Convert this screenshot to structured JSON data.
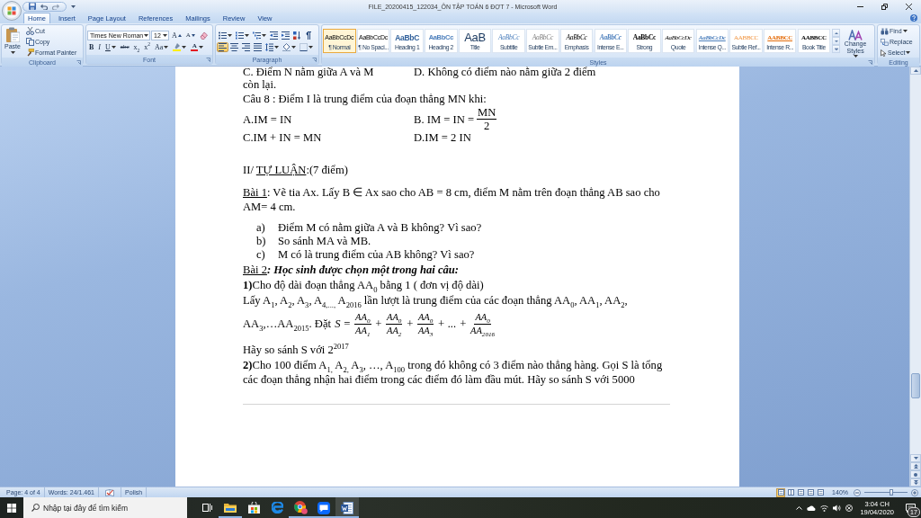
{
  "window": {
    "title": "FILE_20200415_122034_ÔN TẬP TOÁN 6 ĐỢT 7 - Microsoft Word"
  },
  "tabs": [
    {
      "label": "Home",
      "selected": true
    },
    {
      "label": "Insert",
      "selected": false
    },
    {
      "label": "Page Layout",
      "selected": false
    },
    {
      "label": "References",
      "selected": false
    },
    {
      "label": "Mailings",
      "selected": false
    },
    {
      "label": "Review",
      "selected": false
    },
    {
      "label": "View",
      "selected": false
    }
  ],
  "ribbon": {
    "clipboard": {
      "label": "Clipboard",
      "paste": "Paste",
      "commands": [
        {
          "kind": "cut",
          "label": "Cut"
        },
        {
          "kind": "copy",
          "label": "Copy"
        },
        {
          "kind": "painter",
          "label": "Format Painter"
        }
      ]
    },
    "font": {
      "label": "Font",
      "family": "Times New Roman",
      "size": "12",
      "row_1": [
        {
          "kind": "grow",
          "text": "A"
        },
        {
          "kind": "shrink",
          "text": "A"
        },
        {
          "kind": "clear"
        }
      ],
      "row_2": [
        {
          "kind": "bold",
          "text": "B"
        },
        {
          "kind": "italic",
          "text": "I"
        },
        {
          "kind": "underline",
          "text": "U"
        },
        {
          "kind": "strike",
          "text": "abc"
        },
        {
          "kind": "subscript",
          "text": "x$_{2}$"
        },
        {
          "kind": "superscript",
          "text": "x$^{2}$"
        },
        {
          "kind": "case",
          "text": "Aa"
        },
        {
          "kind": "highlight"
        },
        {
          "kind": "color",
          "text": "A"
        }
      ]
    },
    "paragraph": {
      "label": "Paragraph",
      "row_1": [
        {
          "kind": "bullets"
        },
        {
          "kind": "numbering"
        },
        {
          "kind": "multilevel"
        },
        {
          "kind": "outdent"
        },
        {
          "kind": "indent"
        },
        {
          "kind": "sort"
        },
        {
          "kind": "marks"
        }
      ],
      "row_2": [
        {
          "kind": "left",
          "selected": true
        },
        {
          "kind": "center",
          "selected": false
        },
        {
          "kind": "right",
          "selected": false
        },
        {
          "kind": "justify",
          "selected": false
        },
        {
          "kind": "spacing"
        },
        {
          "kind": "shading"
        },
        {
          "kind": "borders"
        }
      ]
    },
    "styles": {
      "label": "Styles",
      "items": [
        {
          "kind": "normal",
          "sample": "AaBbCcDc",
          "label": "¶ Normal",
          "selected": true
        },
        {
          "kind": "nospacing",
          "sample": "AaBbCcDc",
          "label": "¶ No Spaci...",
          "selected": false
        },
        {
          "kind": "heading1",
          "sample": "AaBbC",
          "label": "Heading 1",
          "selected": false
        },
        {
          "kind": "heading2",
          "sample": "AaBbCc",
          "label": "Heading 2",
          "selected": false
        },
        {
          "kind": "title",
          "sample": "AaB",
          "label": "Title",
          "selected": false
        },
        {
          "kind": "subtitle",
          "sample": "AaBbCc",
          "label": "Subtitle",
          "selected": false
        },
        {
          "kind": "subtleemphasis",
          "sample": "AaBbCc",
          "label": "Subtle Em...",
          "selected": false
        },
        {
          "kind": "emphasis",
          "sample": "AaBbCc",
          "label": "Emphasis",
          "selected": false
        },
        {
          "kind": "intenseemphasis",
          "sample": "AaBbCc",
          "label": "Intense E...",
          "selected": false
        },
        {
          "kind": "strong",
          "sample": "AaBbCc",
          "label": "Strong",
          "selected": false
        },
        {
          "kind": "quote",
          "sample": "AaBbCcDc",
          "label": "Quote",
          "selected": false
        },
        {
          "kind": "intensequote",
          "sample": "AaBbCcDc",
          "label": "Intense Q...",
          "selected": false
        },
        {
          "kind": "subtlereference",
          "sample": "AABBCC",
          "label": "Subtle Ref...",
          "selected": false
        },
        {
          "kind": "intensereference",
          "sample": "AABBCC",
          "label": "Intense R...",
          "selected": false
        },
        {
          "kind": "booktitle",
          "sample": "AABBCC",
          "label": "Book Title",
          "selected": false
        }
      ],
      "change_styles": "Change Styles"
    },
    "editing": {
      "label": "Editing",
      "commands": [
        {
          "kind": "find",
          "label": "Find"
        },
        {
          "kind": "replace",
          "label": "Replace"
        },
        {
          "kind": "select",
          "label": "Select"
        }
      ]
    }
  },
  "document": {
    "blocks": [
      {
        "kind": "options",
        "items": [
          {
            "text": "C. Điểm N nằm giữa A và M"
          },
          {
            "text": "D. Không có điểm nào nằm giữa 2 điểm"
          }
        ]
      },
      {
        "kind": "paragraph",
        "text": "còn lại."
      },
      {
        "kind": "paragraph",
        "text": "Câu 8 : Điểm I là trung điểm của đoạn thẳng MN khi:"
      },
      {
        "kind": "options",
        "items": [
          {
            "text": "A.IM = IN"
          },
          {
            "text": "B. IM = IN =",
            "fraction": {
              "numerator": "MN",
              "denominator": "2"
            }
          }
        ]
      },
      {
        "kind": "options",
        "items": [
          {
            "text": "C.IM + IN = MN"
          },
          {
            "text": "D.IM = 2 IN"
          }
        ]
      },
      {
        "kind": "section",
        "prefix": "II/ ",
        "underlined": "TỰ LUẬN",
        "suffix": ":(7 điểm)"
      },
      {
        "kind": "exercise",
        "label": "Bài 1",
        "text": ": Vẽ tia Ax. Lấy B ∈ Ax sao cho AB = 8 cm, điểm M nằm trên đoạn thẳng AB sao cho AM= 4 cm.",
        "emphasis": false
      },
      {
        "kind": "list",
        "items": [
          {
            "marker": "a)",
            "text": "Điểm M có nằm giữa A và B không? Vì sao?"
          },
          {
            "marker": "b)",
            "text": "So sánh MA và MB."
          },
          {
            "marker": "c)",
            "text": "M có là trung điểm của AB không? Vì sao?"
          }
        ]
      },
      {
        "kind": "exercise",
        "label": "Bài 2",
        "text": ": Học sinh được chọn một trong hai câu:",
        "emphasis": true
      },
      {
        "kind": "paragraph",
        "text": "**1)**Cho độ dài đoạn thẳng AA$_{0}$ bằng 1 ( đơn vị độ dài)"
      },
      {
        "kind": "paragraph",
        "text": "Lấy A$_{1}$, A$_{2}$, A$_{3}$, A$_{4,...,}$ A$_{2016}$ lần lượt là trung điểm của các đoạn thẳng AA$_{0}$, AA$_{1}$, AA$_{2}$,"
      },
      {
        "kind": "formula",
        "text": "AA$_{3}$,…AA$_{2015}$. Đặt",
        "terms": [
          {
            "kind": "symbol",
            "text": "S ="
          },
          {
            "kind": "fraction",
            "numerator": "AA$_{0}$",
            "denominator": "AA$_{1}$"
          },
          {
            "kind": "symbol",
            "text": "+"
          },
          {
            "kind": "fraction",
            "numerator": "AA$_{0}$",
            "denominator": "AA$_{2}$"
          },
          {
            "kind": "symbol",
            "text": "+"
          },
          {
            "kind": "fraction",
            "numerator": "AA$_{0}$",
            "denominator": "AA$_{3}$"
          },
          {
            "kind": "symbol",
            "text": "+ ... +"
          },
          {
            "kind": "fraction",
            "numerator": "AA$_{0}$",
            "denominator": "AA$_{2016}$"
          }
        ]
      },
      {
        "kind": "paragraph",
        "text": "Hãy so sánh S với 2$^{2017}$"
      },
      {
        "kind": "paragraph",
        "text": "**2)**Cho 100 điểm A$_{1,}$ A$_{2,}$ A$_{3}$, …, A$_{100}$ trong đó không có 3 điểm nào thẳng hàng. Gọi S là tổng các đoạn thẳng nhận hai điểm trong các điểm đó làm đầu mút. Hãy so sánh S với 5000"
      }
    ]
  },
  "status_bar": {
    "page": "Page: 4 of 4",
    "words": "Words: 24/1.461",
    "language": "Polish",
    "views": [
      {
        "kind": "print",
        "selected": true
      },
      {
        "kind": "reading",
        "selected": false
      },
      {
        "kind": "web",
        "selected": false
      },
      {
        "kind": "outline",
        "selected": false
      },
      {
        "kind": "draft",
        "selected": false
      }
    ],
    "zoom": "140%",
    "zoom_slider": {
      "level": 0.62
    }
  },
  "taskbar": {
    "search": {
      "placeholder": "Nhập tại đây để tìm kiếm"
    },
    "apps": [
      {
        "kind": "taskview",
        "open": false,
        "selected": false
      },
      {
        "kind": "explorer",
        "open": true,
        "selected": false
      },
      {
        "kind": "store",
        "open": false,
        "selected": false
      },
      {
        "kind": "edge",
        "open": false,
        "selected": false
      },
      {
        "kind": "chrome",
        "open": true,
        "selected": false
      },
      {
        "kind": "zalo",
        "open": true,
        "selected": false
      },
      {
        "kind": "word",
        "open": true,
        "selected": true
      }
    ],
    "time": "3:04 CH",
    "date": "19/04/2020",
    "notifications": "17"
  }
}
